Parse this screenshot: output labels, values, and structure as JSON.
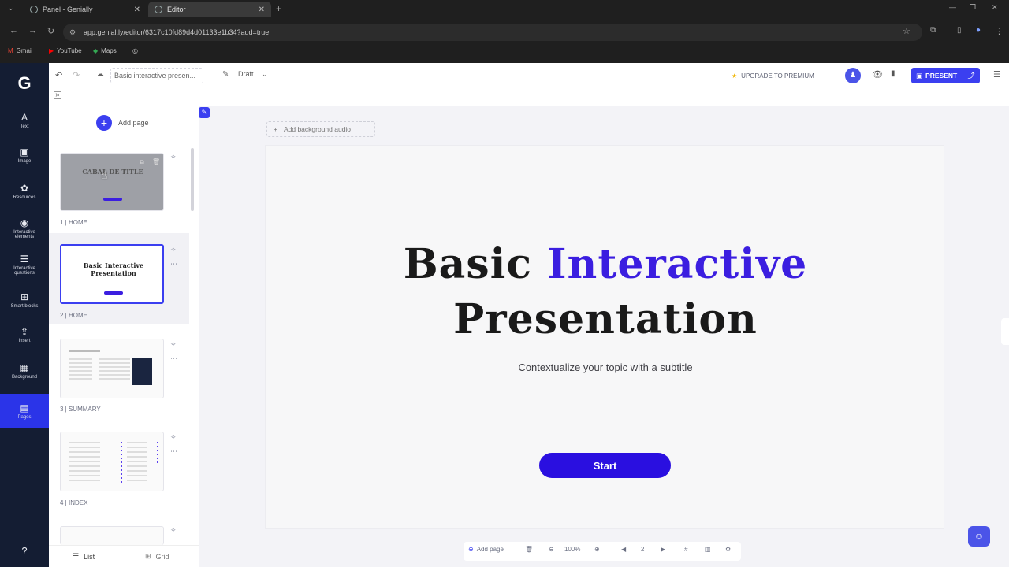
{
  "browser": {
    "tabs": [
      {
        "label": "Panel - Genially"
      },
      {
        "label": "Editor"
      }
    ],
    "new_tab": "+",
    "url": "app.genial.ly/editor/6317c10fd89d4d01133e1b34?add=true",
    "bookmarks": [
      {
        "label": "Gmail"
      },
      {
        "label": "YouTube"
      },
      {
        "label": "Maps"
      }
    ]
  },
  "app": {
    "rail": [
      {
        "label": "Text",
        "icon": "text-icon"
      },
      {
        "label": "Image",
        "icon": "image-icon"
      },
      {
        "label": "Resources",
        "icon": "resources-icon"
      },
      {
        "label": "Interactive elements",
        "icon": "interactive-icon"
      },
      {
        "label": "Interactive questions",
        "icon": "questions-icon"
      },
      {
        "label": "Smart blocks",
        "icon": "blocks-icon"
      },
      {
        "label": "Insert",
        "icon": "insert-icon"
      },
      {
        "label": "Background",
        "icon": "background-icon"
      },
      {
        "label": "Pages",
        "icon": "pages-icon"
      }
    ],
    "doc_title": "Basic interactive presen...",
    "status": "Draft",
    "upgrade": "UPGRADE TO PREMIUM",
    "present": "PRESENT",
    "add_page": "Add page",
    "add_audio": "Add background audio",
    "pages": [
      {
        "label": "1 | HOME",
        "thumb_title": "CABAL DE TITLE"
      },
      {
        "label": "2 | HOME",
        "thumb_title": "Basic Interactive Presentation"
      },
      {
        "label": "3 | SUMMARY"
      },
      {
        "label": "4 | INDEX"
      }
    ],
    "list_label": "List",
    "grid_label": "Grid",
    "slide": {
      "title_plain": "Basic ",
      "title_highlight": "Interactive",
      "title_line2": "Presentation",
      "subtitle": "Contextualize your topic with a subtitle",
      "button": "Start"
    },
    "bottom": {
      "add_page": "Add page",
      "zoom": "100%",
      "page_num": "2"
    },
    "accent": "#2a0fe0"
  }
}
